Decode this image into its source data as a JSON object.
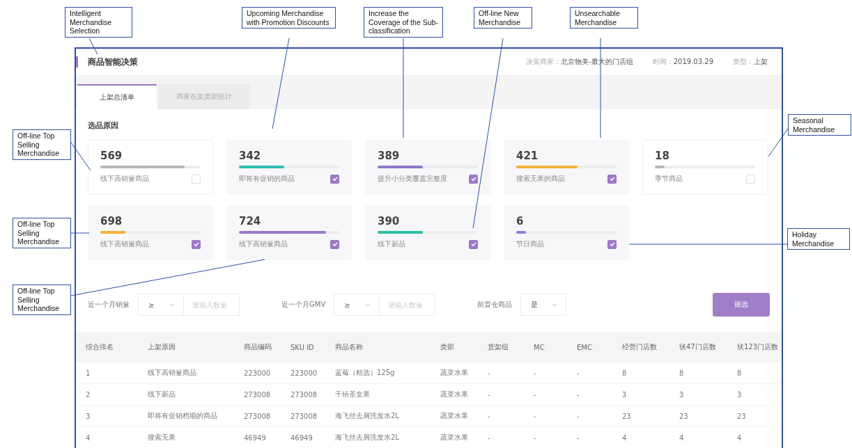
{
  "annotations": [
    {
      "text": "Intelligent Merchandise Selection"
    },
    {
      "text": "Upcoming Merchandise with Promotion Discounts"
    },
    {
      "text": "Increase the Coverage of the Sub-classification"
    },
    {
      "text": "Off-line New Merchandise"
    },
    {
      "text": "Unsearchable Merchandise"
    },
    {
      "text": "Seasonal Merchandise"
    },
    {
      "text": "Off-line Top Selling Merchandise"
    },
    {
      "text": "Off-line Top Selling Merchandise"
    },
    {
      "text": "Holiday Merchandise"
    },
    {
      "text": "Off-line Top Selling Merchandise"
    }
  ],
  "header": {
    "title": "商品智能决策",
    "meta": [
      {
        "label": "决策商家：",
        "value": "北京物美-最大的门店组"
      },
      {
        "label": "时间：",
        "value": "2019.03.29"
      },
      {
        "label": "类型：",
        "value": "上架"
      }
    ]
  },
  "tabs": [
    {
      "label": "上架总清单",
      "selected": true
    },
    {
      "label": "商家在架类部统计",
      "selected": false
    }
  ],
  "section_title": "选品原因",
  "cards": [
    {
      "count": "569",
      "level": 0.84,
      "color": "#b8b8b8",
      "label": "线下高销量商品",
      "checked": false
    },
    {
      "count": "342",
      "level": 0.45,
      "color": "#2dbfae",
      "label": "即将有促销的商品",
      "checked": true
    },
    {
      "count": "389",
      "level": 0.45,
      "color": "#8f78cc",
      "label": "提升小分类覆盖完整度",
      "checked": true
    },
    {
      "count": "421",
      "level": 0.61,
      "color": "#f4b236",
      "label": "搜索无果的商品",
      "checked": true
    },
    {
      "count": "18",
      "level": 0.1,
      "color": "#b8b8b8",
      "label": "季节商品",
      "checked": false
    },
    {
      "count": "698",
      "level": 0.25,
      "color": "#f4b236",
      "label": "线下高销量商品",
      "checked": true
    },
    {
      "count": "724",
      "level": 0.87,
      "color": "#9a78c9",
      "label": "线下高销量商品",
      "checked": true
    },
    {
      "count": "390",
      "level": 0.45,
      "color": "#2dbfa5",
      "label": "线下新品",
      "checked": true
    },
    {
      "count": "6",
      "level": 0.1,
      "color": "#8a86d6",
      "label": "节日商品",
      "checked": true
    }
  ],
  "filters": [
    {
      "label": "近一个月销量",
      "operator": "≥",
      "placeholder": "请输入数量"
    },
    {
      "label": "近一个月GMV",
      "operator": "≥",
      "placeholder": "请输入数量"
    }
  ],
  "warehouse_filter": {
    "label": "前置仓商品",
    "value": "是"
  },
  "filter_button": "筛选",
  "table": {
    "columns": [
      "综合排名",
      "上架原因",
      "商品编码",
      "SKU ID",
      "商品名称",
      "类部",
      "货架组",
      "MC",
      "EMC",
      "经营门店数",
      "状47门店数",
      "状123门店数"
    ],
    "rows": [
      [
        "1",
        "线下高销量商品",
        "223000",
        "223000",
        "蓝莓（精选）125g",
        "蔬菜水果",
        "-",
        "-",
        "-",
        "8",
        "8",
        "8"
      ],
      [
        "2",
        "线下新品",
        "273008",
        "273008",
        "千禧圣女果",
        "蔬菜水果",
        "-",
        "-",
        "-",
        "3",
        "3",
        "3"
      ],
      [
        "3",
        "即将有促销档期的商品",
        "273008",
        "273008",
        "海飞丝去屑洗发水2L",
        "蔬菜水果",
        "-",
        "-",
        "-",
        "23",
        "23",
        "23"
      ],
      [
        "4",
        "搜索无果",
        "46949",
        "46949",
        "海飞丝去屑洗发水2L",
        "蔬菜水果",
        "-",
        "-",
        "-",
        "4",
        "4",
        "4"
      ]
    ]
  }
}
